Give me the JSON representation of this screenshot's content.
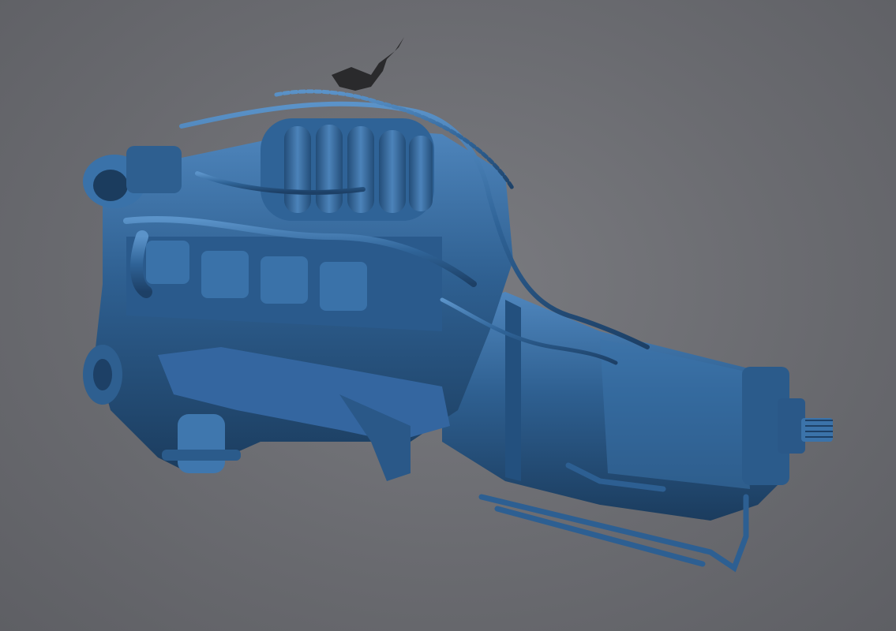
{
  "viewport": {
    "background_color": "#6b6c71",
    "model_color": "#2e5f90",
    "model_highlight_color": "#4f86bd",
    "model_shadow_color": "#1b3c5e",
    "scan_artifact_color": "#2a2a2c"
  },
  "model": {
    "subject": "engine-and-transmission-3d-scan"
  }
}
